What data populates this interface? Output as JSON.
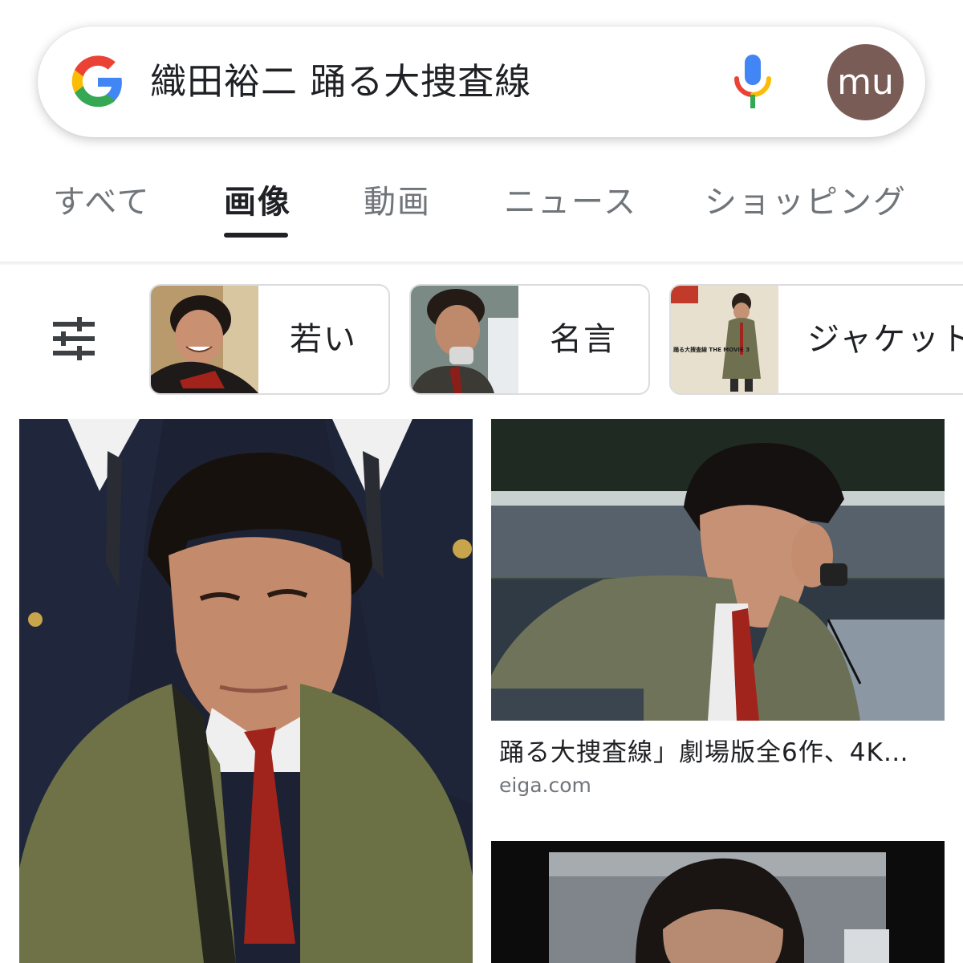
{
  "search": {
    "query": "織田裕二 踊る大捜査線",
    "avatar_initials": "mu"
  },
  "tabs": [
    {
      "label": "すべて"
    },
    {
      "label": "画像",
      "active": true
    },
    {
      "label": "動画"
    },
    {
      "label": "ニュース"
    },
    {
      "label": "ショッピング"
    }
  ],
  "chips": [
    {
      "label": "若い"
    },
    {
      "label": "名言"
    },
    {
      "label": "ジャケット"
    }
  ],
  "results": [
    {
      "title": "",
      "source": ""
    },
    {
      "title": "踊る大捜査線」劇場版全6作、4K…",
      "source": "eiga.com"
    },
    {
      "title": "",
      "source": ""
    }
  ],
  "thumbnail_texts": {
    "chip3_magazine": [
      "踊る大捜査線 THE MOVIE 3"
    ]
  },
  "colors": {
    "google_blue": "#4285F4",
    "google_red": "#EA4335",
    "google_yellow": "#FBBC05",
    "google_green": "#34A853",
    "avatar_bg": "#7a5c57",
    "text_primary": "#202124",
    "text_secondary": "#70757a"
  },
  "icons": {
    "logo": "google-g-icon",
    "voice": "microphone-icon",
    "filter": "tune-sliders-icon"
  }
}
